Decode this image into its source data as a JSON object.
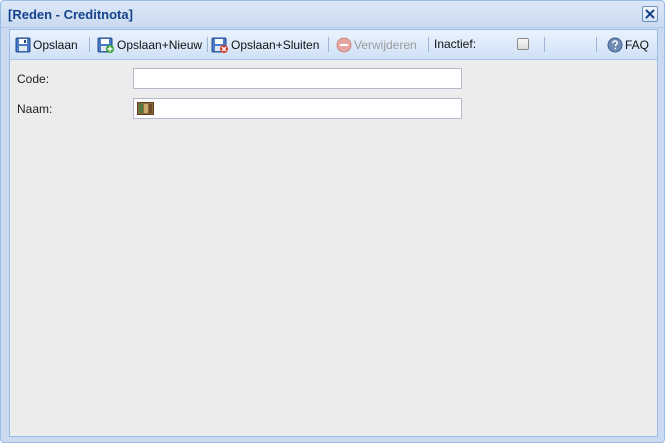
{
  "window": {
    "title": "[Reden - Creditnota]"
  },
  "toolbar": {
    "save_label": "Opslaan",
    "save_new_label": "Opslaan+Nieuw",
    "save_close_label": "Opslaan+Sluiten",
    "delete_label": "Verwijderen",
    "inactive_label": "Inactief:",
    "inactive_checked": false,
    "faq_label": "FAQ"
  },
  "form": {
    "code": {
      "label": "Code:",
      "value": ""
    },
    "naam": {
      "label": "Naam:",
      "value": ""
    }
  },
  "icons": {
    "save": "floppy-disk-icon",
    "save_new": "floppy-disk-plus-icon",
    "save_close": "floppy-disk-close-icon",
    "delete": "minus-circle-icon",
    "faq": "help-globe-icon",
    "close": "close-icon",
    "field_addon": "translation-icon"
  },
  "colors": {
    "title": "#15428b",
    "toolbar_start": "#eaf3fd",
    "toolbar_end": "#cfe1f7",
    "panel_bg": "#ececec",
    "border": "#99bbe8"
  }
}
